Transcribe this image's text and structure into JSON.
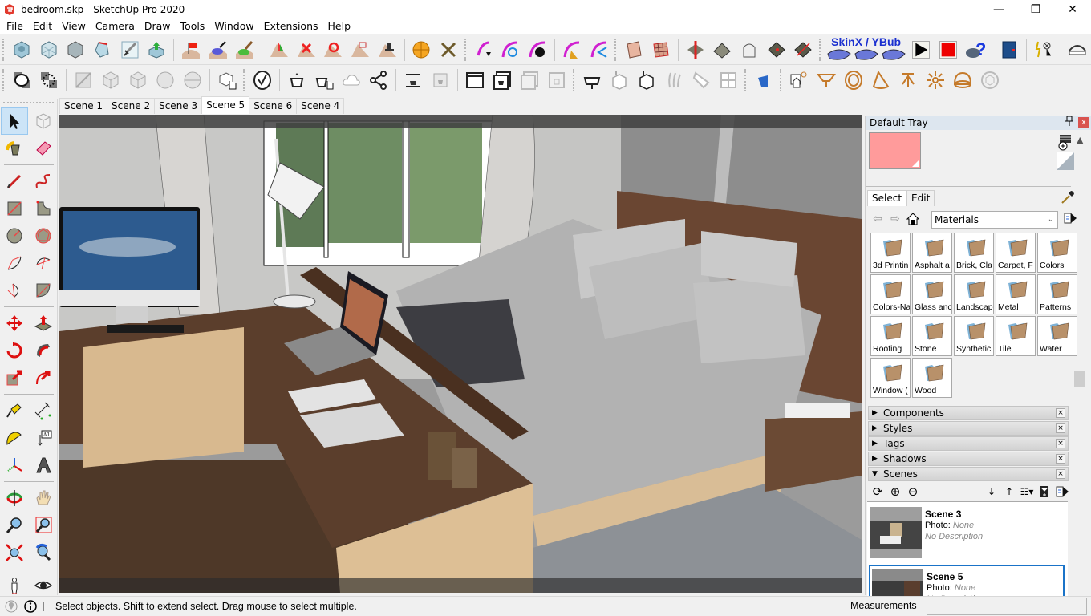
{
  "window": {
    "title": "bedroom.skp - SketchUp Pro 2020",
    "minimize": "—",
    "restore": "❐",
    "close": "✕"
  },
  "menu": [
    "File",
    "Edit",
    "View",
    "Camera",
    "Draw",
    "Tools",
    "Window",
    "Extensions",
    "Help"
  ],
  "toolbar1": {
    "icons": [
      "component-solid-icon",
      "component-wire-icon",
      "component-hidden-icon",
      "unfold-icon",
      "sword-icon",
      "push-green-icon",
      "flag-terrain-icon",
      "drape-icon",
      "smoove-icon",
      "add-detail-icon",
      "flip-edge-icon",
      "rotate-terrain-icon",
      "smoove-red-icon",
      "stamp-icon",
      "solar-north-icon",
      "tools-wrench-icon",
      "curviloft-icon",
      "bezier-rotate-icon",
      "bomb-icon",
      "broom-icon",
      "curve-arrow-icon",
      "contour-icon",
      "grid-mesh-icon",
      "push-pull-arrow-icon",
      "shell-icon",
      "bag-icon",
      "face-point-icon",
      "diagonal-icon"
    ],
    "skinx_label": "SkinX / YBub",
    "play_icon": "play-icon",
    "stop_icon": "stop-icon",
    "help_icon": "help-icon"
  },
  "scene_tabs": [
    {
      "label": "Scene 1",
      "active": false
    },
    {
      "label": "Scene 2",
      "active": false
    },
    {
      "label": "Scene 3",
      "active": false
    },
    {
      "label": "Scene 5",
      "active": true
    },
    {
      "label": "Scene 6",
      "active": false
    },
    {
      "label": "Scene 4",
      "active": false
    }
  ],
  "tray": {
    "title": "Default Tray",
    "pin": "📌",
    "close": "x",
    "materials": {
      "tabs": [
        "Select",
        "Edit"
      ],
      "active_tab": "Select",
      "collection": "Materials",
      "preview_color": "#ff9b9b",
      "items": [
        "3d Printin",
        "Asphalt a",
        "Brick, Cla",
        "Carpet, F",
        "Colors",
        "Colors-Na",
        "Glass anc",
        "Landscap",
        "Metal",
        "Patterns",
        "Roofing",
        "Stone",
        "Synthetic",
        "Tile",
        "Water",
        "Window (",
        "Wood"
      ]
    },
    "panels": [
      {
        "label": "Components",
        "expanded": false
      },
      {
        "label": "Styles",
        "expanded": false
      },
      {
        "label": "Tags",
        "expanded": false
      },
      {
        "label": "Shadows",
        "expanded": false
      },
      {
        "label": "Scenes",
        "expanded": true
      }
    ],
    "scenes": [
      {
        "name": "Scene 3",
        "photo_label": "Photo:",
        "photo_value": "None",
        "description": "No Description",
        "selected": false
      },
      {
        "name": "Scene 5",
        "photo_label": "Photo:",
        "photo_value": "None",
        "description": "No Description",
        "selected": true
      }
    ]
  },
  "status": {
    "message": "Select objects. Shift to extend select. Drag mouse to select multiple.",
    "measurements_label": "Measurements",
    "measurements_value": ""
  }
}
